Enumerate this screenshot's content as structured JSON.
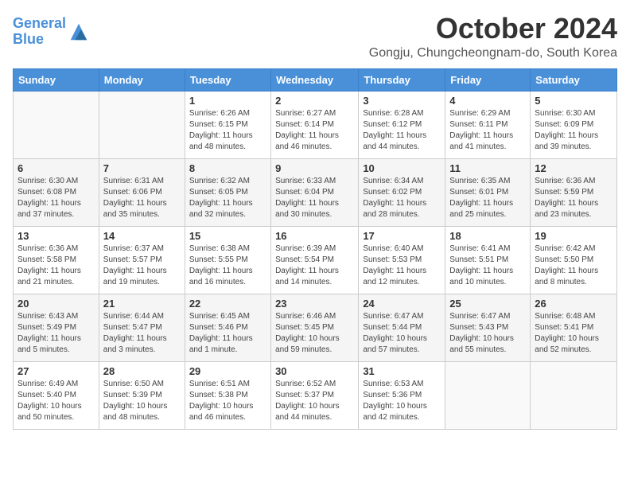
{
  "header": {
    "logo": {
      "line1": "General",
      "line2": "Blue"
    },
    "title": "October 2024",
    "subtitle": "Gongju, Chungcheongnam-do, South Korea"
  },
  "weekdays": [
    "Sunday",
    "Monday",
    "Tuesday",
    "Wednesday",
    "Thursday",
    "Friday",
    "Saturday"
  ],
  "weeks": [
    [
      {
        "day": "",
        "detail": ""
      },
      {
        "day": "",
        "detail": ""
      },
      {
        "day": "1",
        "detail": "Sunrise: 6:26 AM\nSunset: 6:15 PM\nDaylight: 11 hours and 48 minutes."
      },
      {
        "day": "2",
        "detail": "Sunrise: 6:27 AM\nSunset: 6:14 PM\nDaylight: 11 hours and 46 minutes."
      },
      {
        "day": "3",
        "detail": "Sunrise: 6:28 AM\nSunset: 6:12 PM\nDaylight: 11 hours and 44 minutes."
      },
      {
        "day": "4",
        "detail": "Sunrise: 6:29 AM\nSunset: 6:11 PM\nDaylight: 11 hours and 41 minutes."
      },
      {
        "day": "5",
        "detail": "Sunrise: 6:30 AM\nSunset: 6:09 PM\nDaylight: 11 hours and 39 minutes."
      }
    ],
    [
      {
        "day": "6",
        "detail": "Sunrise: 6:30 AM\nSunset: 6:08 PM\nDaylight: 11 hours and 37 minutes."
      },
      {
        "day": "7",
        "detail": "Sunrise: 6:31 AM\nSunset: 6:06 PM\nDaylight: 11 hours and 35 minutes."
      },
      {
        "day": "8",
        "detail": "Sunrise: 6:32 AM\nSunset: 6:05 PM\nDaylight: 11 hours and 32 minutes."
      },
      {
        "day": "9",
        "detail": "Sunrise: 6:33 AM\nSunset: 6:04 PM\nDaylight: 11 hours and 30 minutes."
      },
      {
        "day": "10",
        "detail": "Sunrise: 6:34 AM\nSunset: 6:02 PM\nDaylight: 11 hours and 28 minutes."
      },
      {
        "day": "11",
        "detail": "Sunrise: 6:35 AM\nSunset: 6:01 PM\nDaylight: 11 hours and 25 minutes."
      },
      {
        "day": "12",
        "detail": "Sunrise: 6:36 AM\nSunset: 5:59 PM\nDaylight: 11 hours and 23 minutes."
      }
    ],
    [
      {
        "day": "13",
        "detail": "Sunrise: 6:36 AM\nSunset: 5:58 PM\nDaylight: 11 hours and 21 minutes."
      },
      {
        "day": "14",
        "detail": "Sunrise: 6:37 AM\nSunset: 5:57 PM\nDaylight: 11 hours and 19 minutes."
      },
      {
        "day": "15",
        "detail": "Sunrise: 6:38 AM\nSunset: 5:55 PM\nDaylight: 11 hours and 16 minutes."
      },
      {
        "day": "16",
        "detail": "Sunrise: 6:39 AM\nSunset: 5:54 PM\nDaylight: 11 hours and 14 minutes."
      },
      {
        "day": "17",
        "detail": "Sunrise: 6:40 AM\nSunset: 5:53 PM\nDaylight: 11 hours and 12 minutes."
      },
      {
        "day": "18",
        "detail": "Sunrise: 6:41 AM\nSunset: 5:51 PM\nDaylight: 11 hours and 10 minutes."
      },
      {
        "day": "19",
        "detail": "Sunrise: 6:42 AM\nSunset: 5:50 PM\nDaylight: 11 hours and 8 minutes."
      }
    ],
    [
      {
        "day": "20",
        "detail": "Sunrise: 6:43 AM\nSunset: 5:49 PM\nDaylight: 11 hours and 5 minutes."
      },
      {
        "day": "21",
        "detail": "Sunrise: 6:44 AM\nSunset: 5:47 PM\nDaylight: 11 hours and 3 minutes."
      },
      {
        "day": "22",
        "detail": "Sunrise: 6:45 AM\nSunset: 5:46 PM\nDaylight: 11 hours and 1 minute."
      },
      {
        "day": "23",
        "detail": "Sunrise: 6:46 AM\nSunset: 5:45 PM\nDaylight: 10 hours and 59 minutes."
      },
      {
        "day": "24",
        "detail": "Sunrise: 6:47 AM\nSunset: 5:44 PM\nDaylight: 10 hours and 57 minutes."
      },
      {
        "day": "25",
        "detail": "Sunrise: 6:47 AM\nSunset: 5:43 PM\nDaylight: 10 hours and 55 minutes."
      },
      {
        "day": "26",
        "detail": "Sunrise: 6:48 AM\nSunset: 5:41 PM\nDaylight: 10 hours and 52 minutes."
      }
    ],
    [
      {
        "day": "27",
        "detail": "Sunrise: 6:49 AM\nSunset: 5:40 PM\nDaylight: 10 hours and 50 minutes."
      },
      {
        "day": "28",
        "detail": "Sunrise: 6:50 AM\nSunset: 5:39 PM\nDaylight: 10 hours and 48 minutes."
      },
      {
        "day": "29",
        "detail": "Sunrise: 6:51 AM\nSunset: 5:38 PM\nDaylight: 10 hours and 46 minutes."
      },
      {
        "day": "30",
        "detail": "Sunrise: 6:52 AM\nSunset: 5:37 PM\nDaylight: 10 hours and 44 minutes."
      },
      {
        "day": "31",
        "detail": "Sunrise: 6:53 AM\nSunset: 5:36 PM\nDaylight: 10 hours and 42 minutes."
      },
      {
        "day": "",
        "detail": ""
      },
      {
        "day": "",
        "detail": ""
      }
    ]
  ]
}
